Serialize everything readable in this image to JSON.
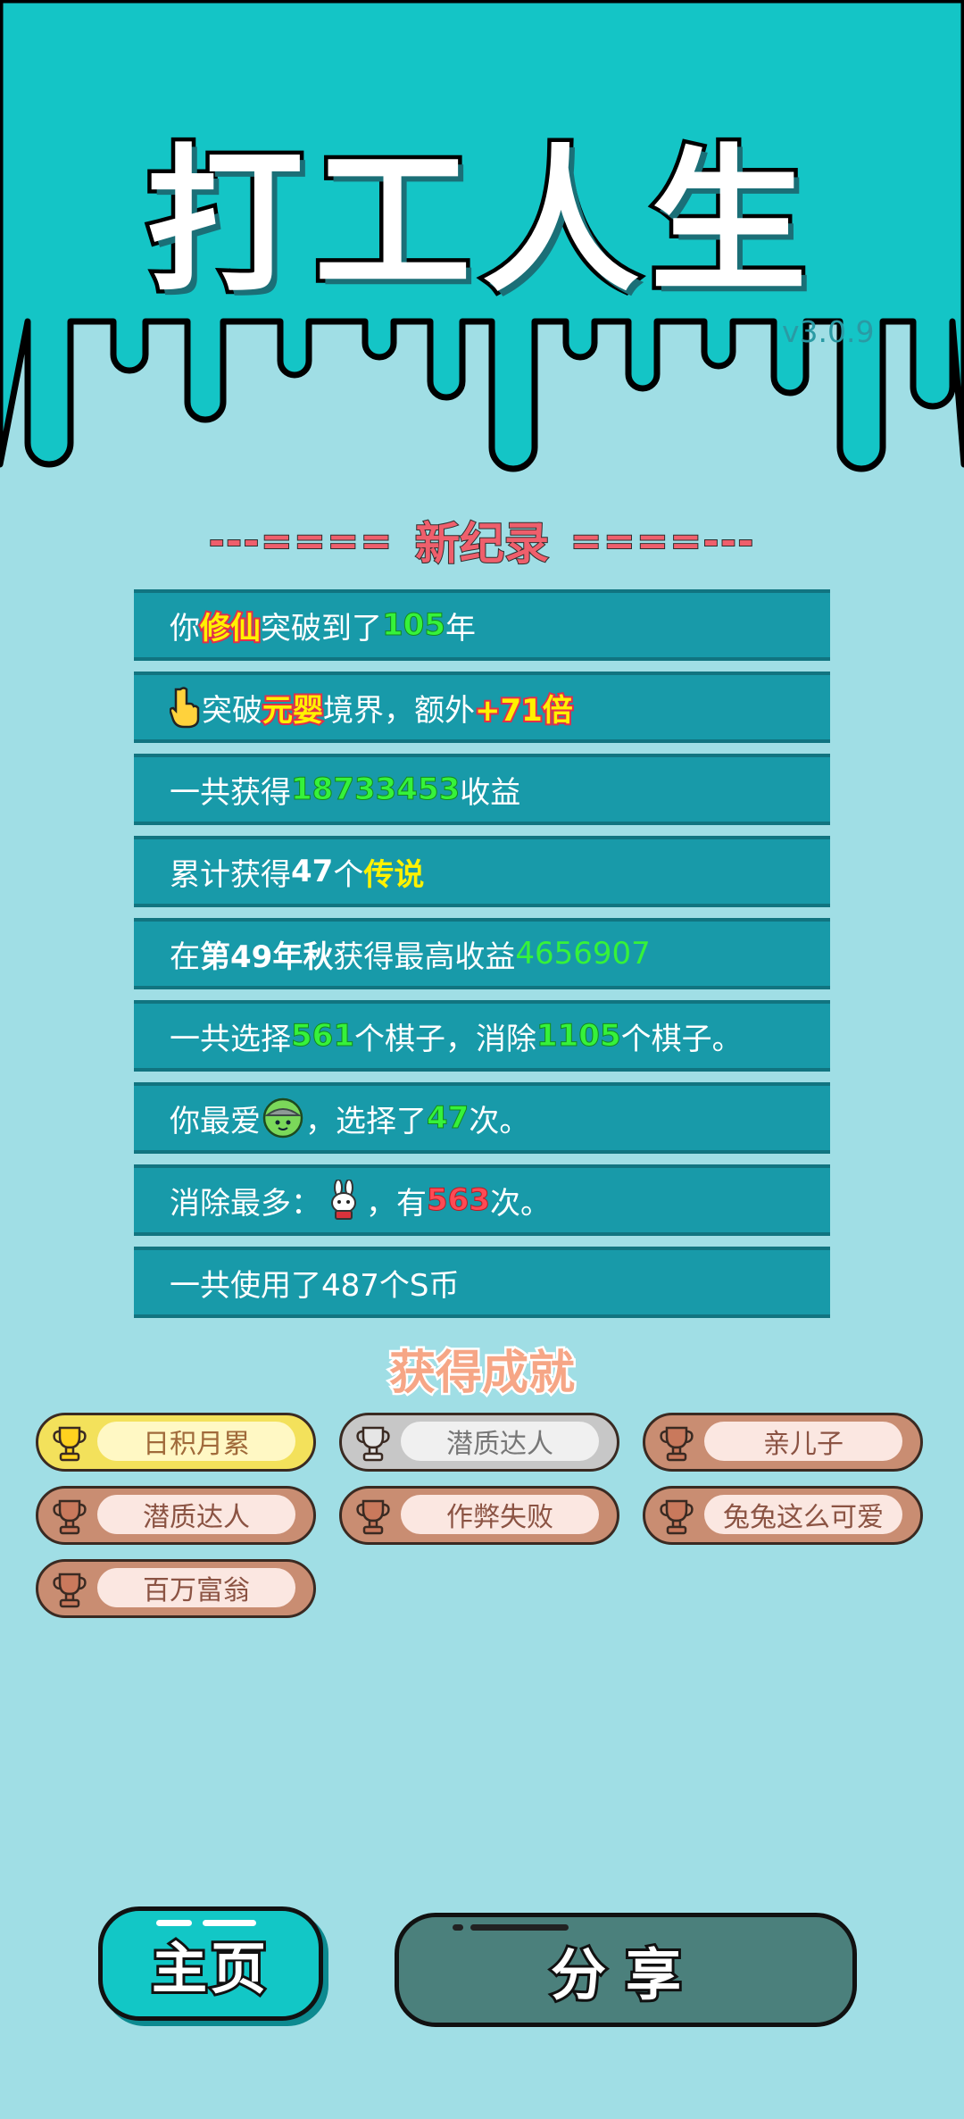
{
  "header": {
    "title": "打工人生",
    "version": "v3.0.9"
  },
  "record_header": {
    "left": "---====",
    "word": "新纪录",
    "right": "====---"
  },
  "stats": {
    "line1": {
      "a": "你 ",
      "b": "修仙",
      "c": "突破到了",
      "d": "105",
      "e": "年"
    },
    "line2": {
      "a": "突破",
      "b": "元婴",
      "c": "境界，额外 ",
      "d": "+71倍"
    },
    "line3": {
      "a": "一共获得",
      "b": "18733453",
      "c": "收益"
    },
    "line4": {
      "a": "累计获得",
      "b": "47",
      "c": "个",
      "d": "传说"
    },
    "line5": {
      "a": "在 ",
      "b": "第49年秋",
      "c": " 获得最高收益",
      "d": "4656907"
    },
    "line6": {
      "a": "一共选择",
      "b": "561",
      "c": "个棋子，消除",
      "d": "1105",
      "e": "个棋子。"
    },
    "line7": {
      "a": "你最爱",
      "c": "，选择了",
      "d": "47",
      "e": "次。"
    },
    "line8": {
      "a": "消除最多：",
      "c": "，有",
      "d": "563",
      "e": "次。"
    },
    "line9": {
      "a": "一共使用了487个S币"
    }
  },
  "achievements": {
    "title": "获得成就",
    "items": [
      {
        "label": "日积月累",
        "tier": "gold"
      },
      {
        "label": "潜质达人",
        "tier": "silver"
      },
      {
        "label": "亲儿子",
        "tier": "bronze"
      },
      {
        "label": "潜质达人",
        "tier": "bronze"
      },
      {
        "label": "作弊失败",
        "tier": "bronze"
      },
      {
        "label": "兔兔这么可爱",
        "tier": "bronze"
      },
      {
        "label": "百万富翁",
        "tier": "bronze"
      }
    ]
  },
  "buttons": {
    "home": "主页",
    "share": "分享"
  },
  "colors": {
    "accent": "#12c7c6",
    "panel": "#189aa9",
    "highlight_green": "#36f23a",
    "highlight_red": "#ff4a54"
  }
}
